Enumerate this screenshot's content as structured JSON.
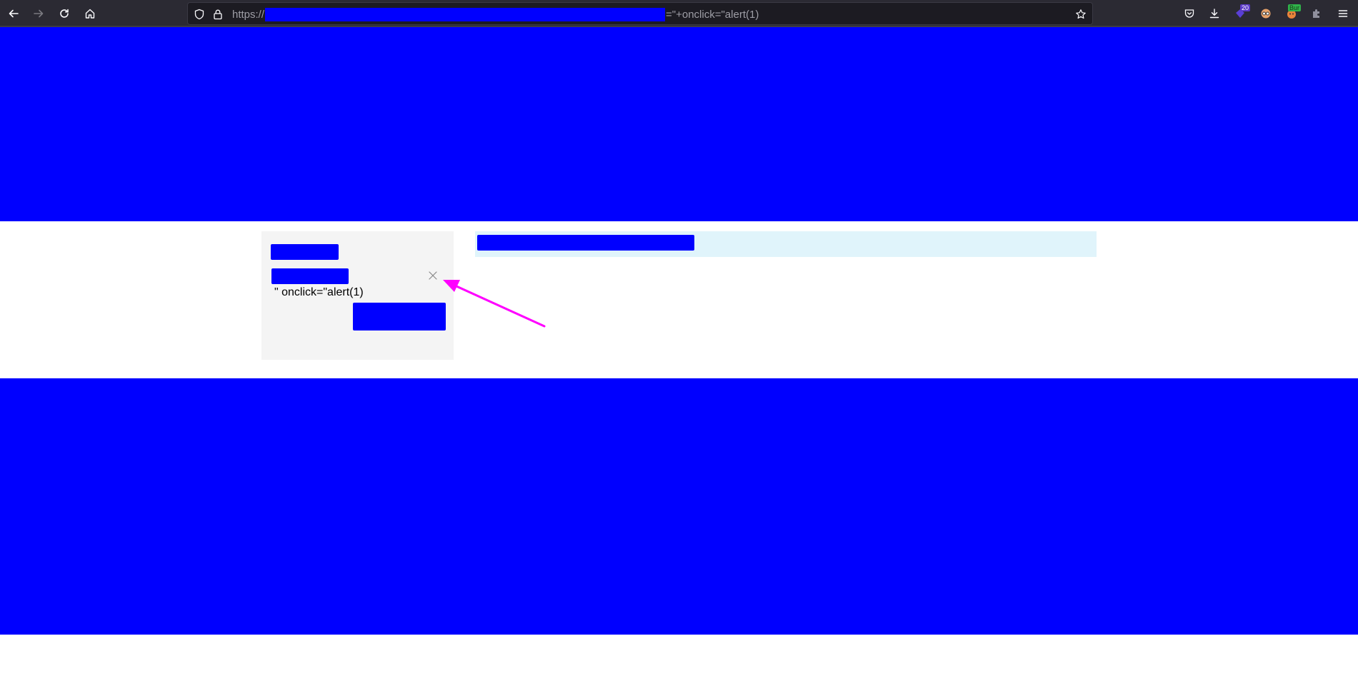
{
  "browser": {
    "url_scheme": "https://",
    "url_visible_tail": "=\"+onclick=\"alert(1)",
    "extension_badges": [
      "20",
      "Bur"
    ],
    "colors": {
      "redaction": "#0000ff",
      "annotation_arrow": "#ff00ff"
    }
  },
  "page": {
    "injected_text": "\" onclick=\"alert(1)"
  }
}
